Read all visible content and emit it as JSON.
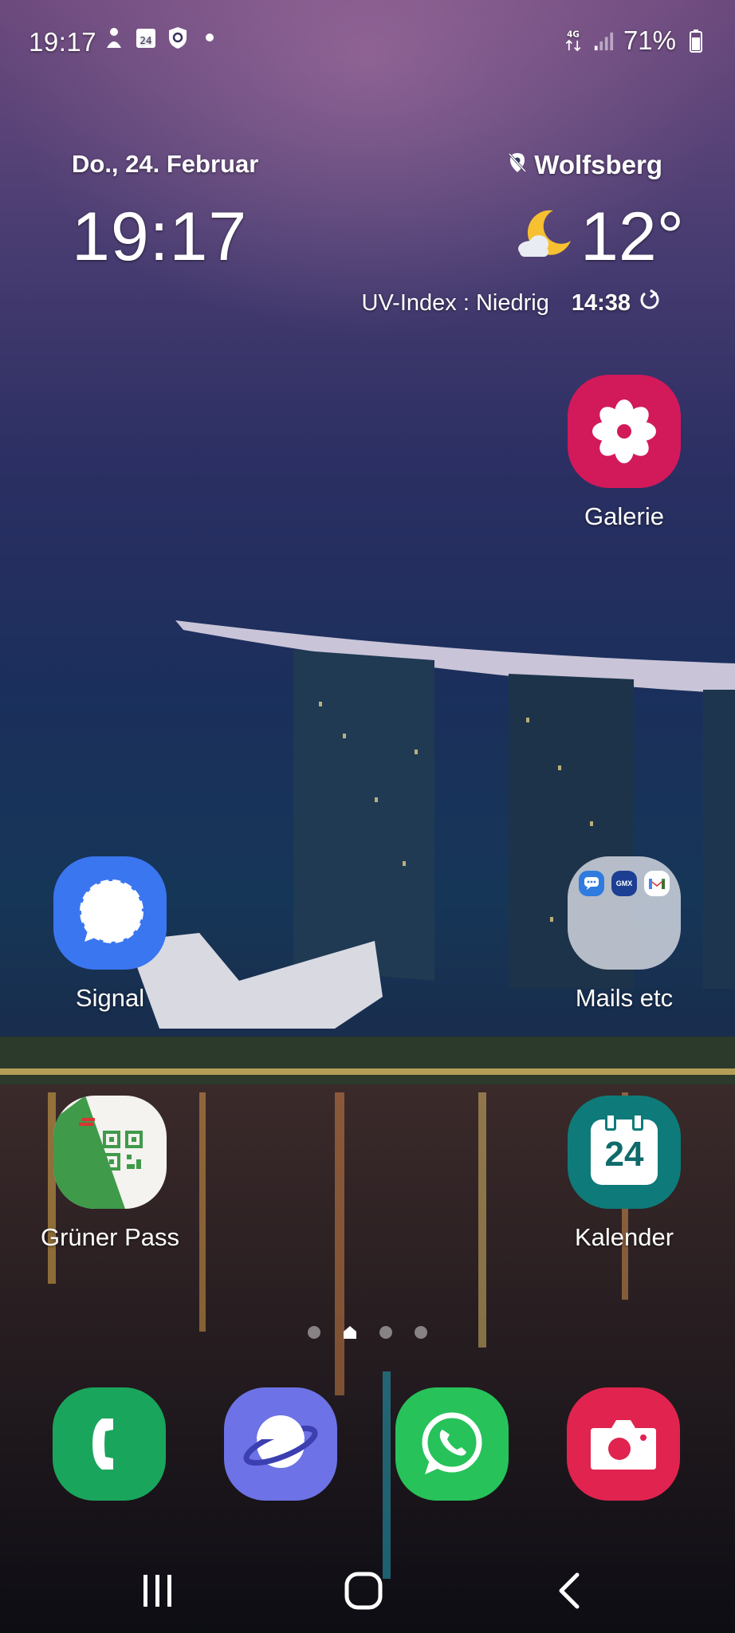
{
  "status_bar": {
    "time": "19:17",
    "left_icons": [
      "notification-person-icon",
      "calendar-24-icon",
      "shield-icon",
      "dot-icon"
    ],
    "calendar_icon_number": "24",
    "network_label": "4G",
    "battery": "71%"
  },
  "clock_widget": {
    "date": "Do., 24. Februar",
    "time": "19:17"
  },
  "weather_widget": {
    "location": "Wolfsberg",
    "temperature": "12°",
    "uv_index": "UV-Index : Niedrig",
    "updated_time": "14:38",
    "condition_icon": "moon-cloud-icon"
  },
  "apps": {
    "galerie": "Galerie",
    "signal": "Signal",
    "mails": "Mails etc",
    "gruener_pass": "Grüner Pass",
    "kalender": "Kalender",
    "kalender_day": "24",
    "mails_folder_gmx": "GMX"
  },
  "page_indicator": {
    "pages": 4,
    "current": "home"
  },
  "dock": [
    "phone",
    "internet",
    "whatsapp",
    "camera"
  ],
  "colors": {
    "galerie": "#d2195a",
    "signal": "#3a76f0",
    "gruener_pass": "#3f9a4a",
    "kalender": "#0f7a7a",
    "phone": "#1aa55c",
    "internet": "#6d72e6",
    "whatsapp": "#27c25a",
    "camera": "#e0244f"
  }
}
